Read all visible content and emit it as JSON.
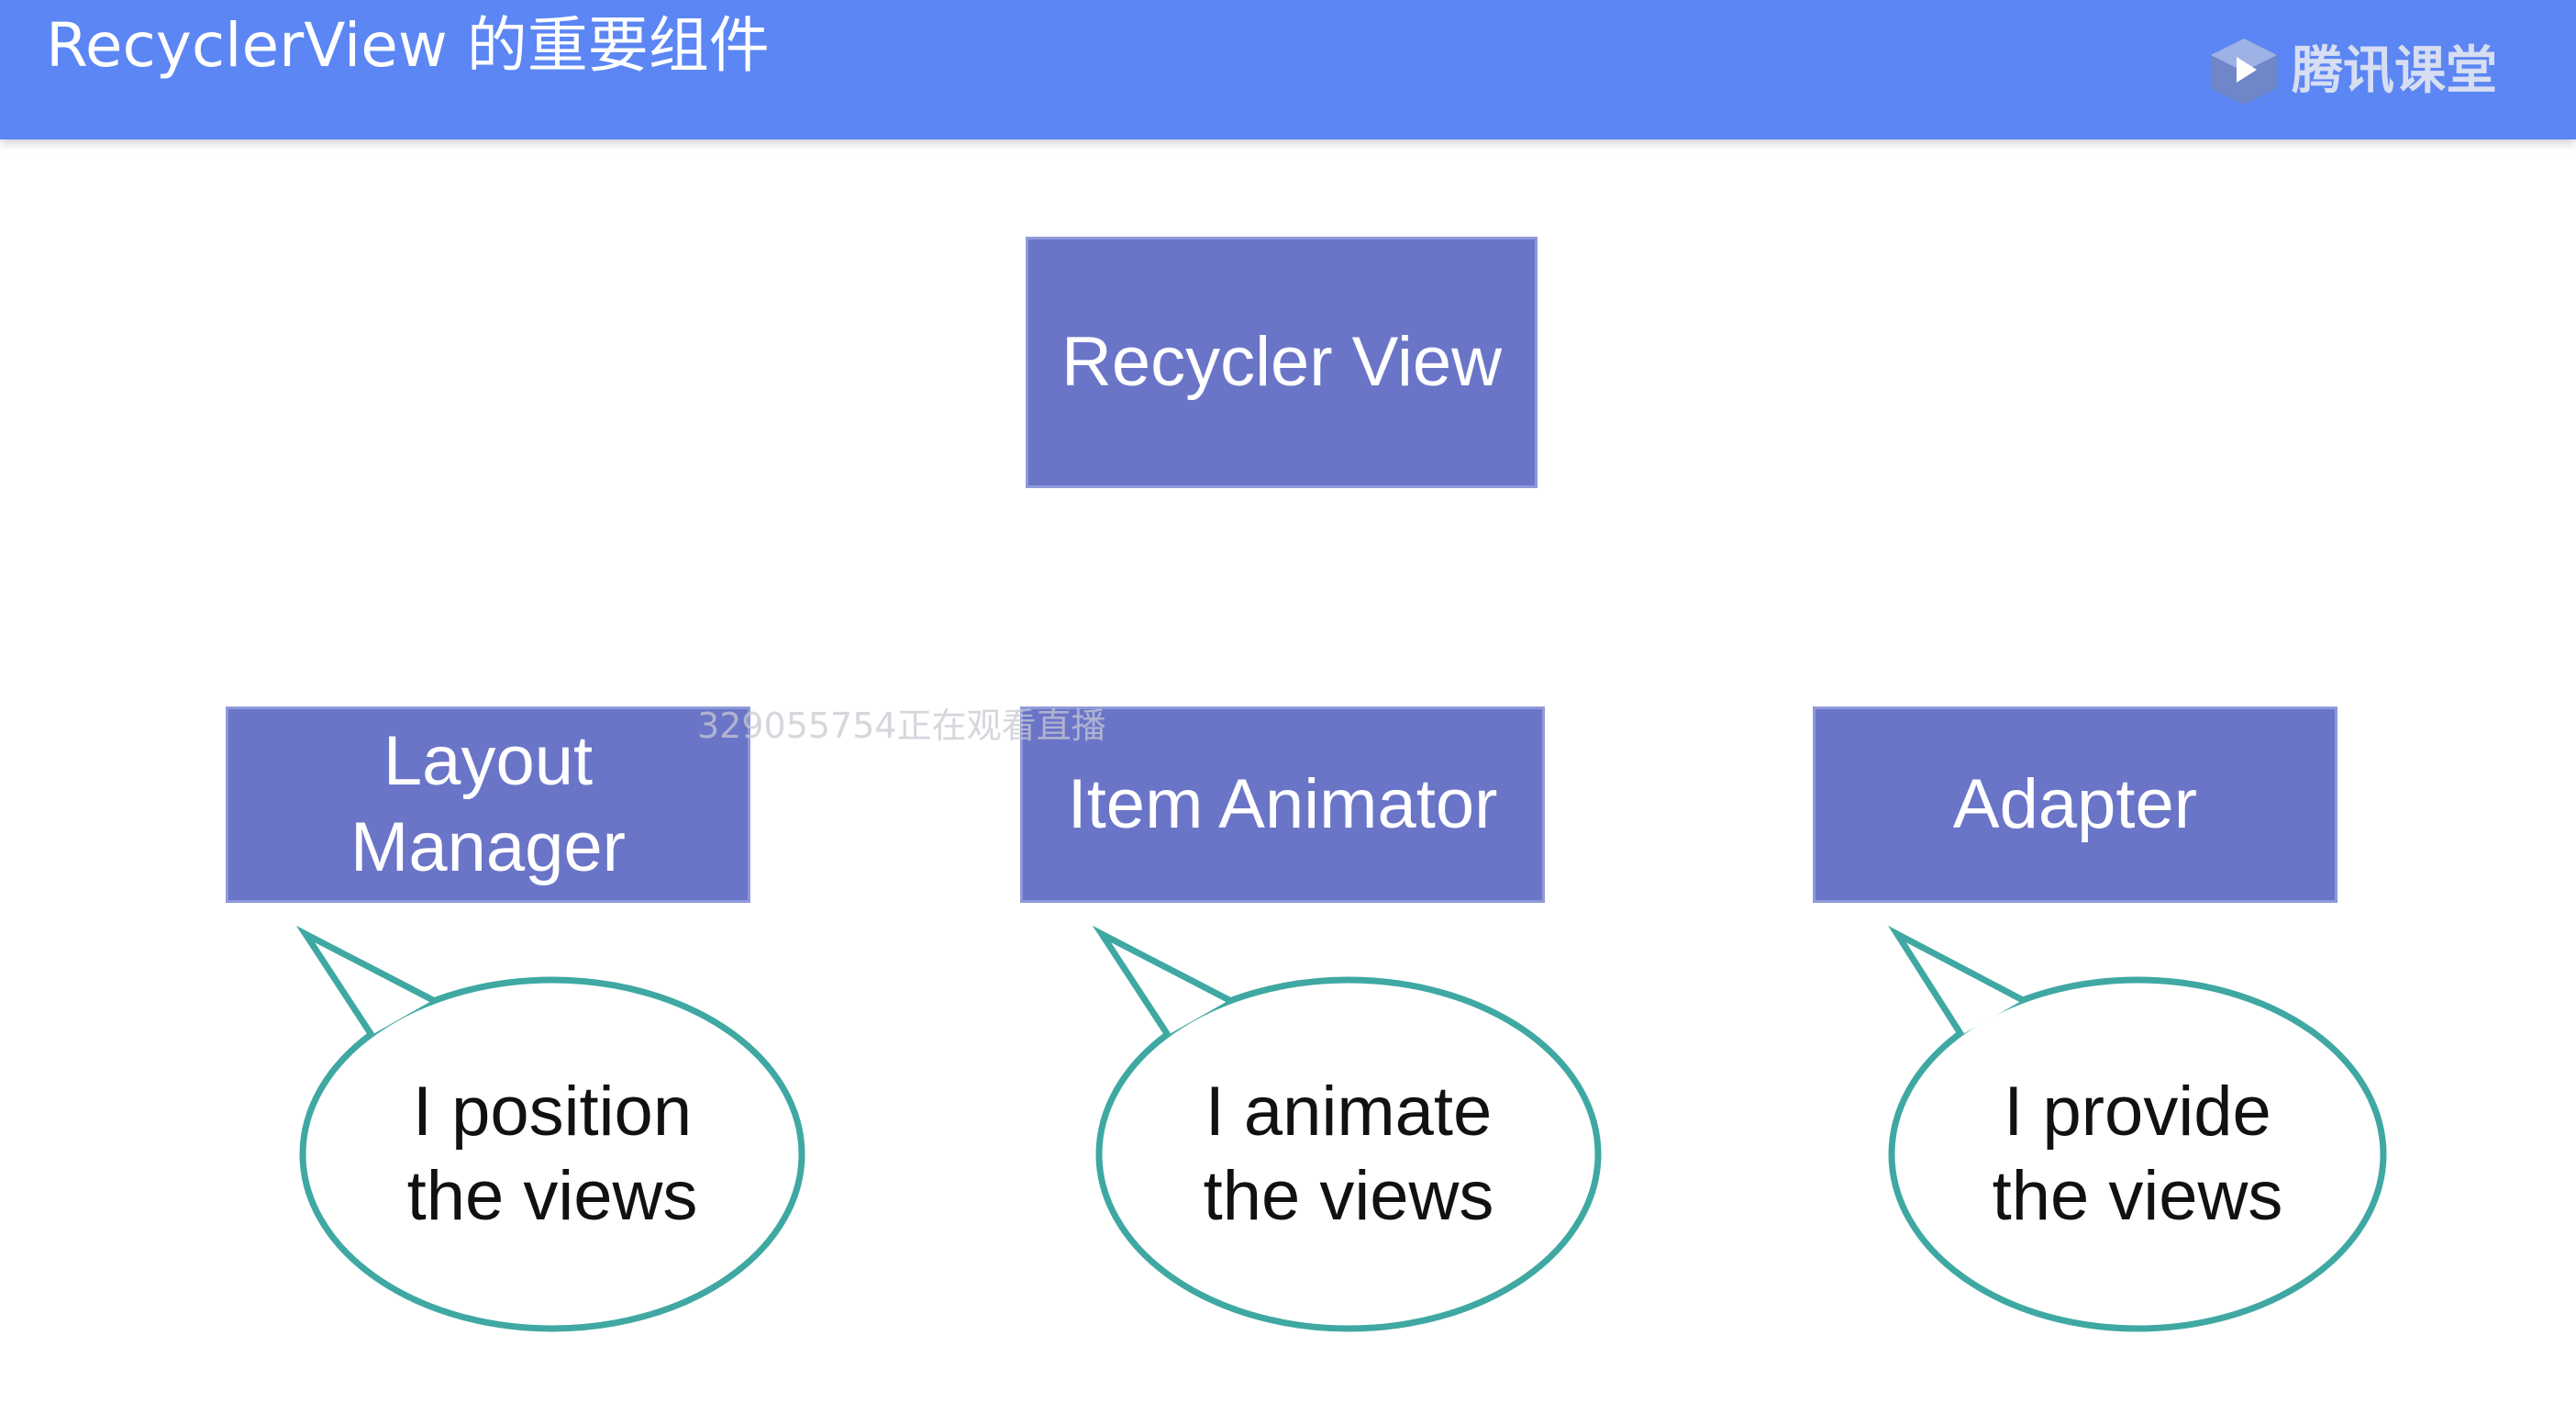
{
  "header": {
    "title": "RecyclerView 的重要组件",
    "brand": "腾讯课堂",
    "brand_icon": "play-hexagon-icon"
  },
  "diagram": {
    "root": "Recycler View",
    "components": [
      {
        "label": "Layout\nManager",
        "bubble": "I position\nthe views"
      },
      {
        "label": "Item Animator",
        "bubble": "I animate\nthe views"
      },
      {
        "label": "Adapter",
        "bubble": "I provide\nthe views"
      }
    ]
  },
  "watermark": "329055754正在观看直播",
  "colors": {
    "header": "#5b86f3",
    "box_fill": "#6a75c8",
    "bubble_stroke": "#3fa8a2"
  }
}
